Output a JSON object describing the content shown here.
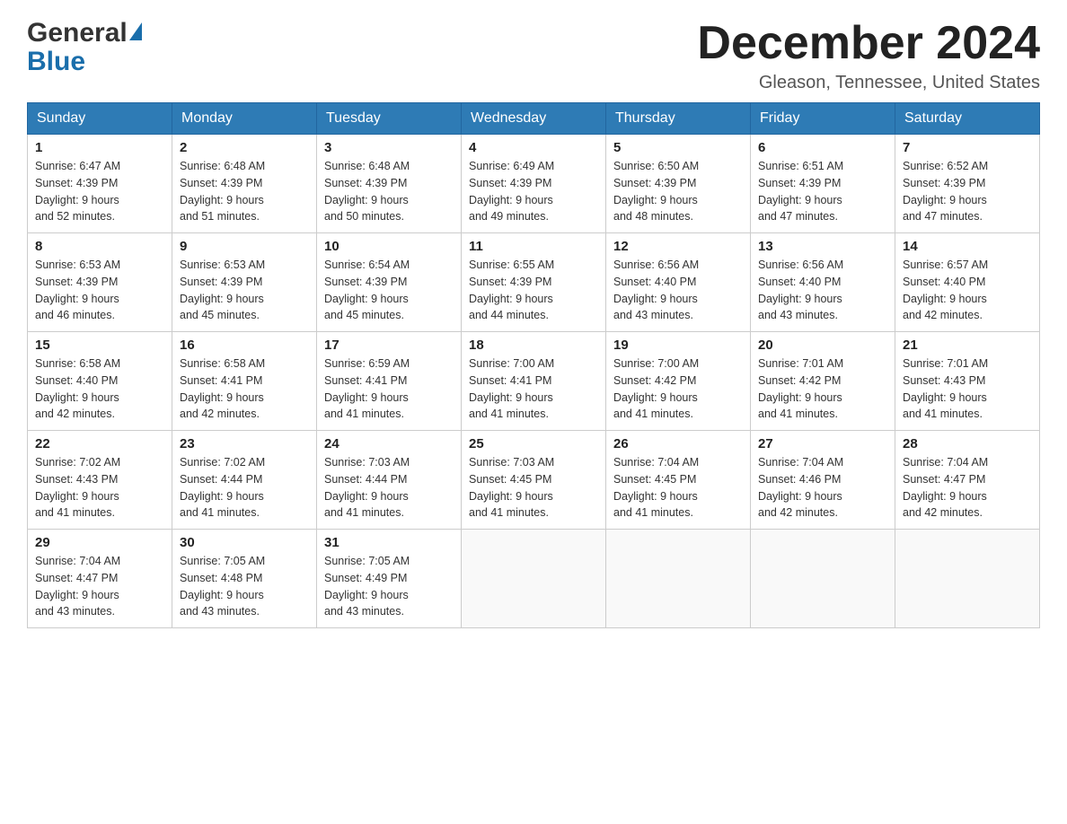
{
  "header": {
    "logo_general": "General",
    "logo_blue": "Blue",
    "month_title": "December 2024",
    "location": "Gleason, Tennessee, United States"
  },
  "days_of_week": [
    "Sunday",
    "Monday",
    "Tuesday",
    "Wednesday",
    "Thursday",
    "Friday",
    "Saturday"
  ],
  "weeks": [
    [
      {
        "day": "1",
        "sunrise": "6:47 AM",
        "sunset": "4:39 PM",
        "daylight": "9 hours and 52 minutes."
      },
      {
        "day": "2",
        "sunrise": "6:48 AM",
        "sunset": "4:39 PM",
        "daylight": "9 hours and 51 minutes."
      },
      {
        "day": "3",
        "sunrise": "6:48 AM",
        "sunset": "4:39 PM",
        "daylight": "9 hours and 50 minutes."
      },
      {
        "day": "4",
        "sunrise": "6:49 AM",
        "sunset": "4:39 PM",
        "daylight": "9 hours and 49 minutes."
      },
      {
        "day": "5",
        "sunrise": "6:50 AM",
        "sunset": "4:39 PM",
        "daylight": "9 hours and 48 minutes."
      },
      {
        "day": "6",
        "sunrise": "6:51 AM",
        "sunset": "4:39 PM",
        "daylight": "9 hours and 47 minutes."
      },
      {
        "day": "7",
        "sunrise": "6:52 AM",
        "sunset": "4:39 PM",
        "daylight": "9 hours and 47 minutes."
      }
    ],
    [
      {
        "day": "8",
        "sunrise": "6:53 AM",
        "sunset": "4:39 PM",
        "daylight": "9 hours and 46 minutes."
      },
      {
        "day": "9",
        "sunrise": "6:53 AM",
        "sunset": "4:39 PM",
        "daylight": "9 hours and 45 minutes."
      },
      {
        "day": "10",
        "sunrise": "6:54 AM",
        "sunset": "4:39 PM",
        "daylight": "9 hours and 45 minutes."
      },
      {
        "day": "11",
        "sunrise": "6:55 AM",
        "sunset": "4:39 PM",
        "daylight": "9 hours and 44 minutes."
      },
      {
        "day": "12",
        "sunrise": "6:56 AM",
        "sunset": "4:40 PM",
        "daylight": "9 hours and 43 minutes."
      },
      {
        "day": "13",
        "sunrise": "6:56 AM",
        "sunset": "4:40 PM",
        "daylight": "9 hours and 43 minutes."
      },
      {
        "day": "14",
        "sunrise": "6:57 AM",
        "sunset": "4:40 PM",
        "daylight": "9 hours and 42 minutes."
      }
    ],
    [
      {
        "day": "15",
        "sunrise": "6:58 AM",
        "sunset": "4:40 PM",
        "daylight": "9 hours and 42 minutes."
      },
      {
        "day": "16",
        "sunrise": "6:58 AM",
        "sunset": "4:41 PM",
        "daylight": "9 hours and 42 minutes."
      },
      {
        "day": "17",
        "sunrise": "6:59 AM",
        "sunset": "4:41 PM",
        "daylight": "9 hours and 41 minutes."
      },
      {
        "day": "18",
        "sunrise": "7:00 AM",
        "sunset": "4:41 PM",
        "daylight": "9 hours and 41 minutes."
      },
      {
        "day": "19",
        "sunrise": "7:00 AM",
        "sunset": "4:42 PM",
        "daylight": "9 hours and 41 minutes."
      },
      {
        "day": "20",
        "sunrise": "7:01 AM",
        "sunset": "4:42 PM",
        "daylight": "9 hours and 41 minutes."
      },
      {
        "day": "21",
        "sunrise": "7:01 AM",
        "sunset": "4:43 PM",
        "daylight": "9 hours and 41 minutes."
      }
    ],
    [
      {
        "day": "22",
        "sunrise": "7:02 AM",
        "sunset": "4:43 PM",
        "daylight": "9 hours and 41 minutes."
      },
      {
        "day": "23",
        "sunrise": "7:02 AM",
        "sunset": "4:44 PM",
        "daylight": "9 hours and 41 minutes."
      },
      {
        "day": "24",
        "sunrise": "7:03 AM",
        "sunset": "4:44 PM",
        "daylight": "9 hours and 41 minutes."
      },
      {
        "day": "25",
        "sunrise": "7:03 AM",
        "sunset": "4:45 PM",
        "daylight": "9 hours and 41 minutes."
      },
      {
        "day": "26",
        "sunrise": "7:04 AM",
        "sunset": "4:45 PM",
        "daylight": "9 hours and 41 minutes."
      },
      {
        "day": "27",
        "sunrise": "7:04 AM",
        "sunset": "4:46 PM",
        "daylight": "9 hours and 42 minutes."
      },
      {
        "day": "28",
        "sunrise": "7:04 AM",
        "sunset": "4:47 PM",
        "daylight": "9 hours and 42 minutes."
      }
    ],
    [
      {
        "day": "29",
        "sunrise": "7:04 AM",
        "sunset": "4:47 PM",
        "daylight": "9 hours and 43 minutes."
      },
      {
        "day": "30",
        "sunrise": "7:05 AM",
        "sunset": "4:48 PM",
        "daylight": "9 hours and 43 minutes."
      },
      {
        "day": "31",
        "sunrise": "7:05 AM",
        "sunset": "4:49 PM",
        "daylight": "9 hours and 43 minutes."
      },
      null,
      null,
      null,
      null
    ]
  ],
  "labels": {
    "sunrise": "Sunrise:",
    "sunset": "Sunset:",
    "daylight": "Daylight:"
  }
}
